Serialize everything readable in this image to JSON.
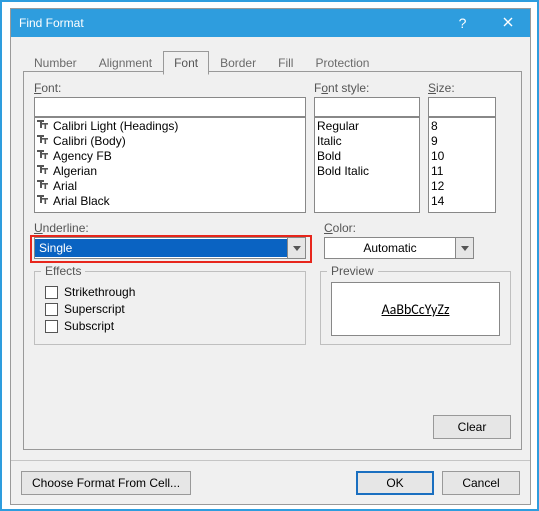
{
  "window": {
    "title": "Find Format"
  },
  "tabs": {
    "items": [
      "Number",
      "Alignment",
      "Font",
      "Border",
      "Fill",
      "Protection"
    ],
    "active_index": 2
  },
  "font_section": {
    "label_html": "Font:",
    "items": [
      "Calibri Light (Headings)",
      "Calibri (Body)",
      "Agency FB",
      "Algerian",
      "Arial",
      "Arial Black"
    ]
  },
  "style_section": {
    "label_html": "Font style:",
    "items": [
      "Regular",
      "Italic",
      "Bold",
      "Bold Italic"
    ]
  },
  "size_section": {
    "label_html": "Size:",
    "items": [
      "8",
      "9",
      "10",
      "11",
      "12",
      "14"
    ]
  },
  "underline": {
    "label": "Underline:",
    "value": "Single"
  },
  "color": {
    "label": "Color:",
    "value": "Automatic"
  },
  "effects": {
    "legend": "Effects",
    "items": [
      {
        "label": "Strikethrough",
        "underline_letter": "k"
      },
      {
        "label": "Superscript",
        "underline_letter": "e"
      },
      {
        "label": "Subscript",
        "underline_letter": "b"
      }
    ]
  },
  "preview": {
    "legend": "Preview",
    "sample": "AaBbCcYyZz"
  },
  "buttons": {
    "clear": "Clear",
    "choose": "Choose Format From Cell...",
    "ok": "OK",
    "cancel": "Cancel"
  }
}
